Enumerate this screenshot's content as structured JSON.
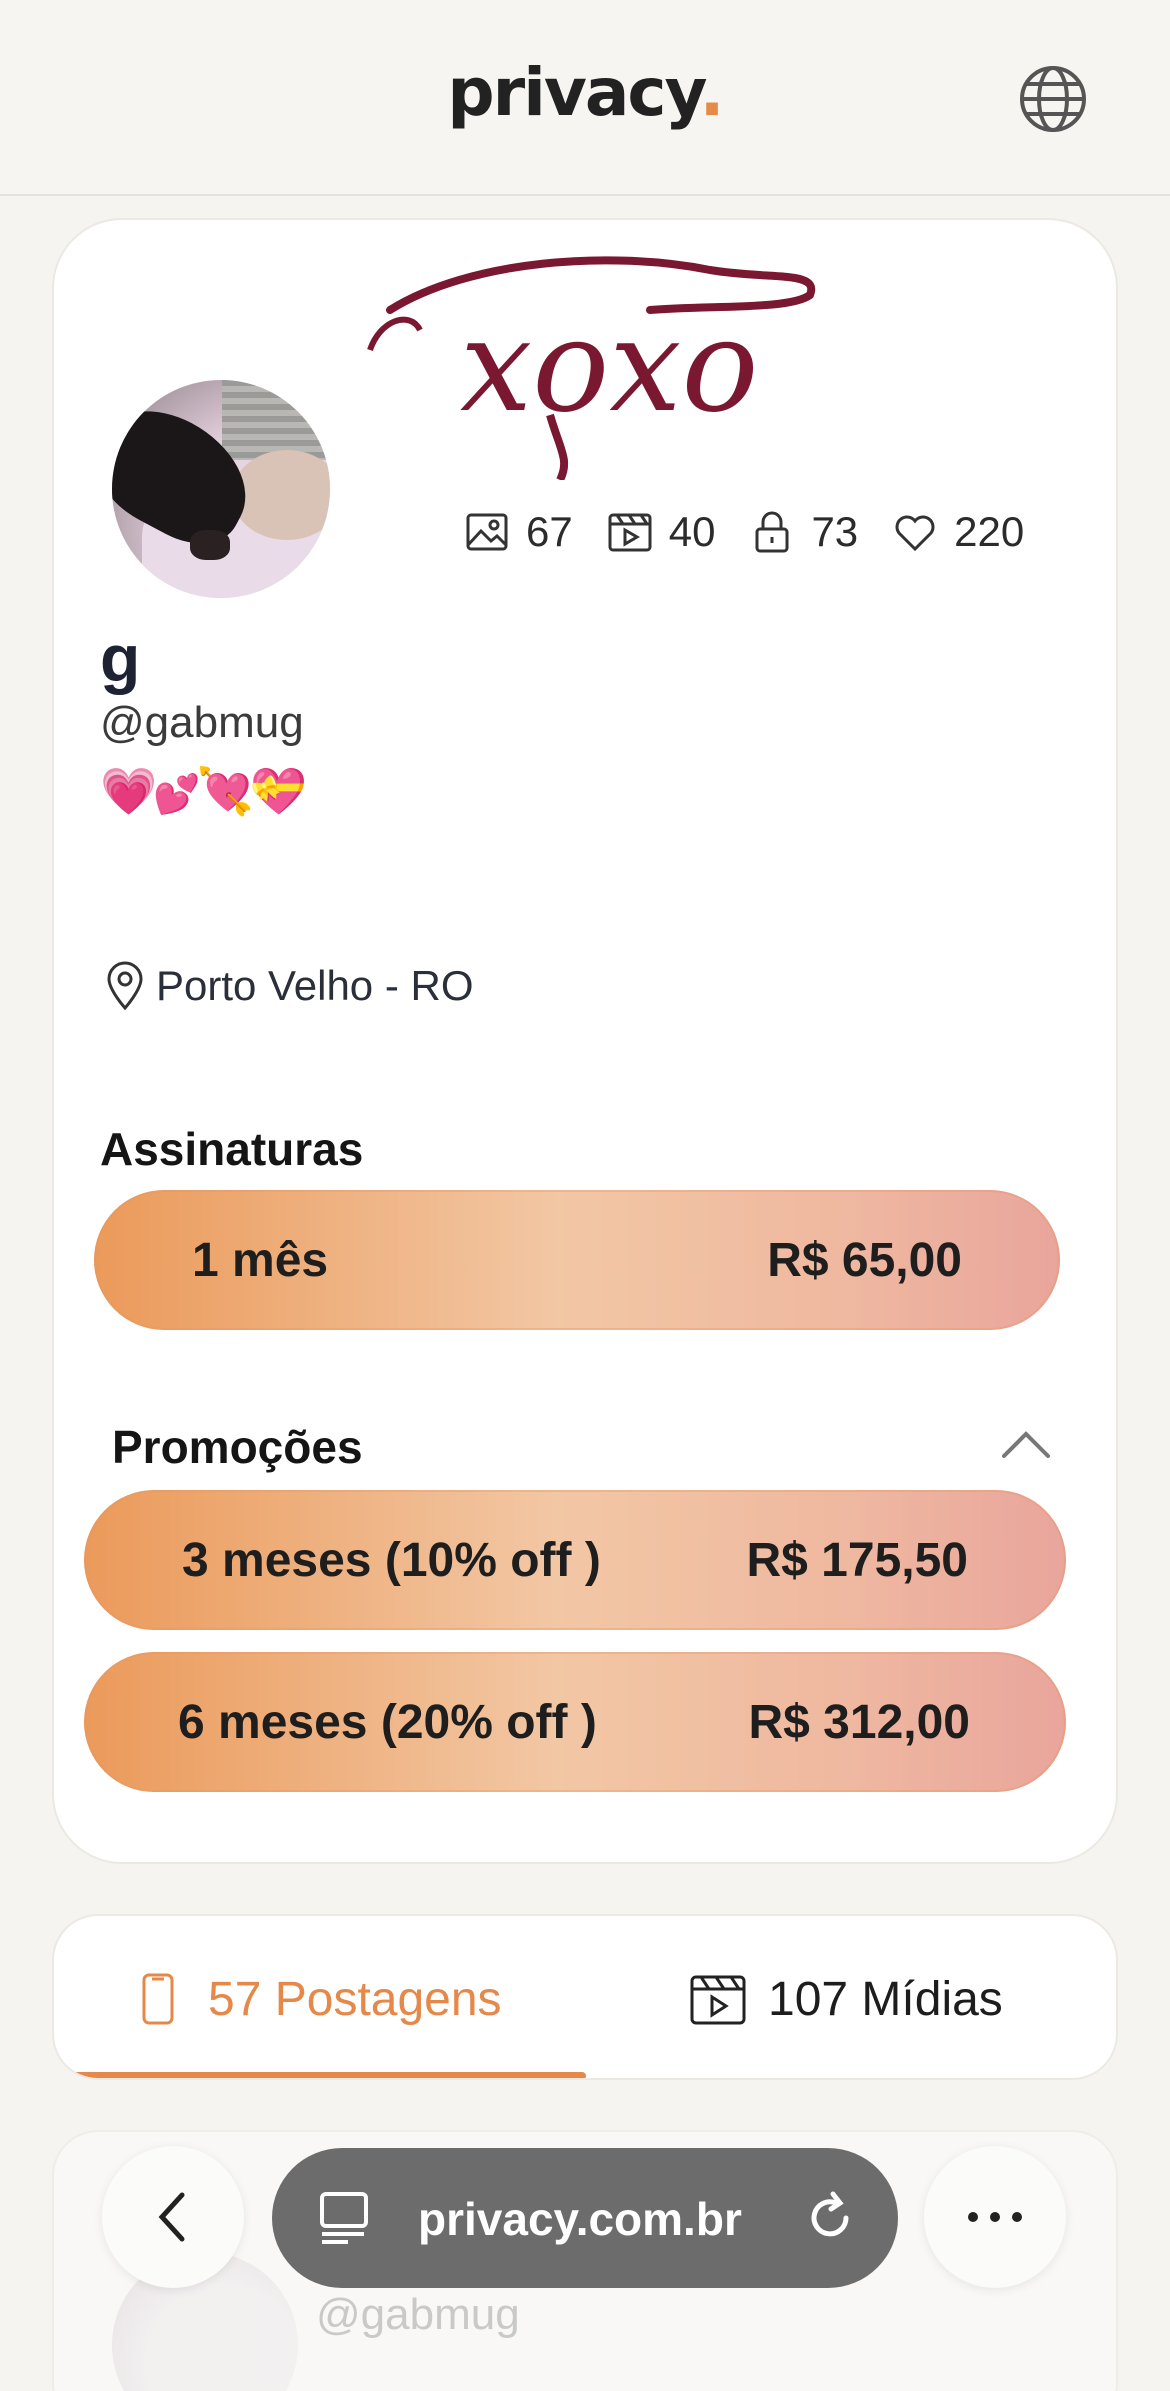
{
  "header": {
    "logo_text": "privacy",
    "logo_dot": ".",
    "globe_icon": "globe-icon"
  },
  "profile": {
    "banner_text": "xoxo",
    "name": "g",
    "handle": "@gabmug",
    "emojis": [
      "💗",
      "💕",
      "💘",
      "💝"
    ],
    "location": "Porto Velho - RO",
    "stats": [
      {
        "icon": "image-icon",
        "value": "67"
      },
      {
        "icon": "video-icon",
        "value": "40"
      },
      {
        "icon": "lock-icon",
        "value": "73"
      },
      {
        "icon": "heart-icon",
        "value": "220"
      }
    ]
  },
  "subscriptions": {
    "title": "Assinaturas",
    "plans": [
      {
        "label": "1 mês",
        "price": "R$ 65,00"
      }
    ]
  },
  "promotions": {
    "title": "Promoções",
    "plans": [
      {
        "label": "3 meses (10% off )",
        "price": "R$ 175,50"
      },
      {
        "label": "6 meses (20% off )",
        "price": "R$ 312,00"
      }
    ]
  },
  "tabs": [
    {
      "label": "57 Postagens",
      "icon": "phone-icon",
      "active": true
    },
    {
      "label": "107 Mídias",
      "icon": "video-icon",
      "active": false
    }
  ],
  "post_preview": {
    "handle": "@gabmug"
  },
  "browser": {
    "url": "privacy.com.br"
  },
  "colors": {
    "accent": "#e5894a",
    "banner": "#7a1832",
    "text": "#1d2333"
  }
}
